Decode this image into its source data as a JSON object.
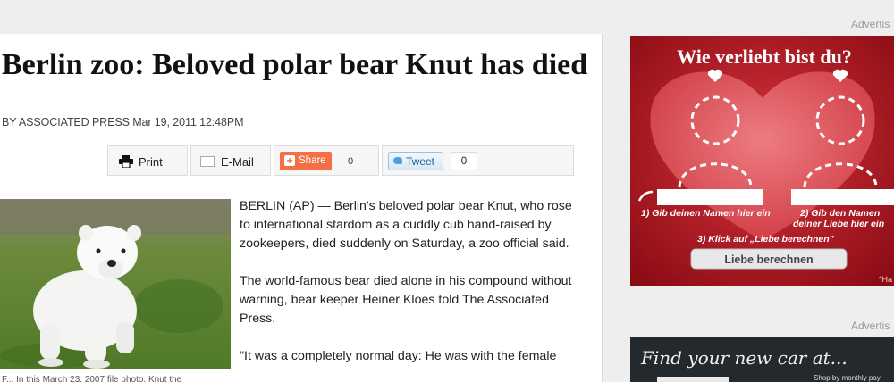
{
  "page": {
    "advert_label_1": "Advertis",
    "advert_label_2": "Advertis"
  },
  "article": {
    "headline": "Berlin zoo: Beloved polar bear Knut has died",
    "byline": "BY ASSOCIATED PRESS Mar 19, 2011 12:48PM",
    "photo_caption": "F... In this March 23, 2007 file photo, Knut the",
    "paragraphs": [
      "BERLIN (AP) — Berlin's beloved polar bear Knut, who rose to international stardom as a cuddly cub hand-raised by zookeepers, died suddenly on Saturday, a zoo official said.",
      "The world-famous bear died alone in his compound without warning, bear keeper Heiner Kloes told The Associated Press.",
      "\"It was a completely normal day: He was with the female"
    ]
  },
  "toolbar": {
    "print_label": "Print",
    "email_label": "E-Mail",
    "share_label": "Share",
    "share_count": "0",
    "tweet_label": "Tweet",
    "tweet_count": "0"
  },
  "ad_love": {
    "title": "Wie verliebt bist du?",
    "step1": "1) Gib deinen Namen hier ein",
    "step2_line1": "2) Gib den Namen",
    "step2_line2": "deiner Liebe hier ein",
    "step3": "3) Klick auf „Liebe berechnen\"",
    "button": "Liebe berechnen",
    "corner": "*Ha",
    "bg_color": "#a3131c"
  },
  "ad_car": {
    "headline": "Find your new car at...",
    "tagline": "Shop by monthly pay"
  }
}
